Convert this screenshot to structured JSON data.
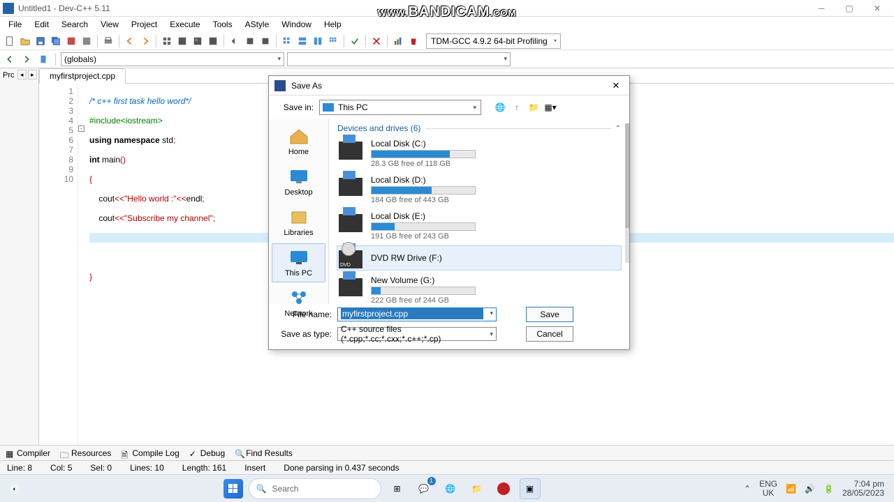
{
  "app": {
    "title": "Untitled1 - Dev-C++ 5.11"
  },
  "watermark": "WWW.BANDICAM.COM",
  "menu": {
    "items": [
      "File",
      "Edit",
      "Search",
      "View",
      "Project",
      "Execute",
      "Tools",
      "AStyle",
      "Window",
      "Help"
    ]
  },
  "compiler_combo": "TDM-GCC 4.9.2 64-bit Profiling",
  "scope_combo": "(globals)",
  "sidepanel": {
    "tab": "Prc"
  },
  "tab": {
    "name": "myfirstproject.cpp"
  },
  "code": {
    "lines": [
      "/* c++ first task hello word*/",
      "#include<iostream>",
      "using namespace std;",
      "int main()",
      "{",
      "    cout<<\"Hello world :\"<<endl;",
      "    cout<<\"Subscribe my channel\";",
      "",
      "",
      "}"
    ]
  },
  "bottom_tabs": [
    "Compiler",
    "Resources",
    "Compile Log",
    "Debug",
    "Find Results"
  ],
  "status": {
    "line": "Line:    8",
    "col": "Col:    5",
    "sel": "Sel:    0",
    "lines": "Lines:    10",
    "length": "Length:    161",
    "insert": "Insert",
    "parse": "Done parsing in 0.437 seconds"
  },
  "dialog": {
    "title": "Save As",
    "save_in_label": "Save in:",
    "location": "This PC",
    "places": [
      {
        "label": "Home"
      },
      {
        "label": "Desktop"
      },
      {
        "label": "Libraries"
      },
      {
        "label": "This PC"
      },
      {
        "label": "Network"
      }
    ],
    "section": "Devices and drives (6)",
    "drives": [
      {
        "name": "Local Disk (C:)",
        "free": "28.3 GB free of 118 GB",
        "pct": 76
      },
      {
        "name": "Local Disk (D:)",
        "free": "184 GB free of 443 GB",
        "pct": 58
      },
      {
        "name": "Local Disk (E:)",
        "free": "191 GB free of 243 GB",
        "pct": 22
      },
      {
        "name": "DVD RW Drive (F:)",
        "free": "",
        "pct": 0
      },
      {
        "name": "New Volume (G:)",
        "free": "222 GB free of 244 GB",
        "pct": 9
      }
    ],
    "filename_label": "File name:",
    "filename": "myfirstproject.cpp",
    "type_label": "Save as type:",
    "type": "C++ source files (*.cpp;*.cc;*.cxx;*.c++;*.cp)",
    "save": "Save",
    "cancel": "Cancel"
  },
  "taskbar": {
    "search_placeholder": "Search",
    "lang1": "ENG",
    "lang2": "UK",
    "time": "7:04 pm",
    "date": "28/05/2023"
  }
}
